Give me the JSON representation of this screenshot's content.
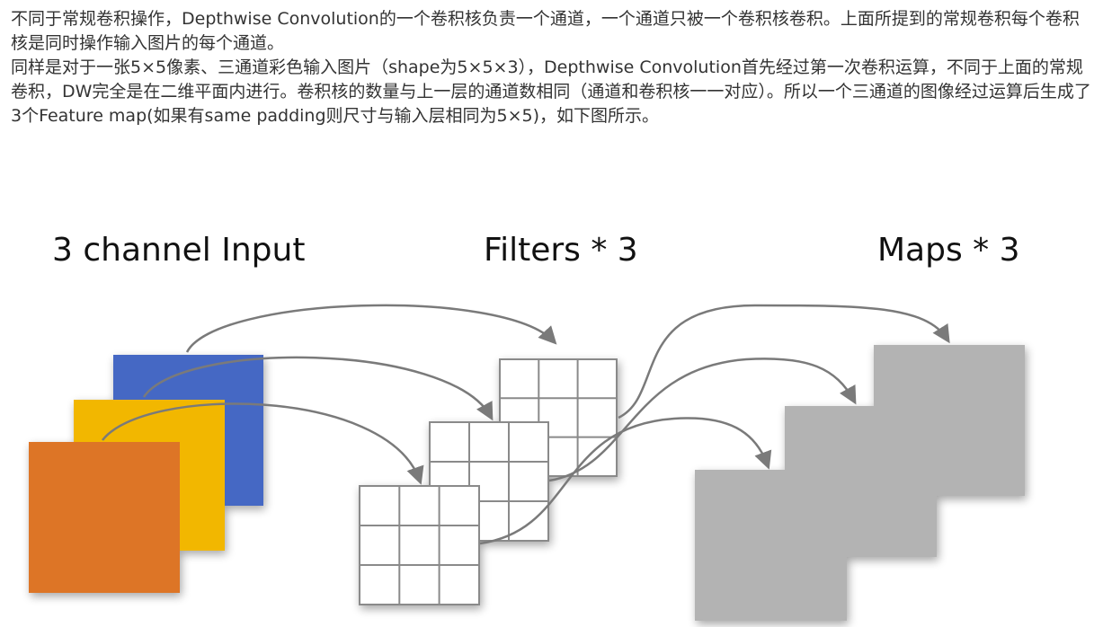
{
  "article": {
    "paragraph1": "不同于常规卷积操作，Depthwise Convolution的一个卷积核负责一个通道，一个通道只被一个卷积核卷积。上面所提到的常规卷积每个卷积核是同时操作输入图片的每个通道。",
    "paragraph2": "同样是对于一张5×5像素、三通道彩色输入图片（shape为5×5×3），Depthwise Convolution首先经过第一次卷积运算，不同于上面的常规卷积，DW完全是在二维平面内进行。卷积核的数量与上一层的通道数相同（通道和卷积核一一对应）。所以一个三通道的图像经过运算后生成了3个Feature map(如果有same padding则尺寸与输入层相同为5×5)，如下图所示。"
  },
  "diagram": {
    "titles": {
      "input": "3 channel Input",
      "filters": "Filters * 3",
      "maps": "Maps * 3"
    },
    "colors": {
      "channel_blue": "#4468c4",
      "channel_yellow": "#f2b705",
      "channel_orange": "#dd7526",
      "map_gray": "#b3b3b3",
      "arrow": "#7a7a7a",
      "grid_line": "#8a8a8a"
    },
    "filter_grid_size": 3
  }
}
